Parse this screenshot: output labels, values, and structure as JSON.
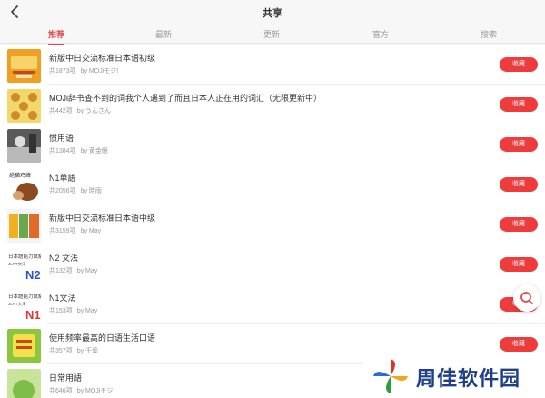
{
  "header": {
    "title": "共享"
  },
  "tabs": [
    {
      "label": "推荐",
      "active": true
    },
    {
      "label": "最新",
      "active": false
    },
    {
      "label": "更新",
      "active": false
    },
    {
      "label": "官方",
      "active": false
    },
    {
      "label": "搜索",
      "active": false
    }
  ],
  "items": [
    {
      "title": "新版中日交流标准日本语初级",
      "count": "共1873项",
      "author": "by MOJiモジ!",
      "collect_label": "收藏",
      "cover_colors": [
        "#f0a020",
        "#f6d36b"
      ]
    },
    {
      "title": "MOJi辞书查不到的词我个人遇到了而且日本人正在用的词汇（无限更新中）",
      "count": "共442项",
      "author": "by うんさん",
      "collect_label": "收藏",
      "cover_colors": [
        "#f2d76a",
        "#d08a2a"
      ]
    },
    {
      "title": "惯用语",
      "count": "共1384项",
      "author": "by 黄金眼",
      "collect_label": "收藏",
      "cover_colors": [
        "#5a5a5a",
        "#b9b9b9"
      ]
    },
    {
      "title": "N1单語",
      "count": "共2056项",
      "author": "by 時雨",
      "collect_label": "收藏",
      "cover_colors": [
        "#8a4a22",
        "#d8a06a"
      ]
    },
    {
      "title": "新版中日交流标准日本语中级",
      "count": "共3159项",
      "author": "by May",
      "collect_label": "收藏",
      "cover_colors": [
        "#f0b020",
        "#6aa84f"
      ]
    },
    {
      "title": "N2 文法",
      "count": "共132项",
      "author": "by May",
      "collect_label": "收藏",
      "cover_colors": [
        "#ffffff",
        "#2a56c6"
      ]
    },
    {
      "title": "N1文法",
      "count": "共153项",
      "author": "by May",
      "collect_label": "收藏",
      "cover_colors": [
        "#ffffff",
        "#d93a3a"
      ]
    },
    {
      "title": "使用频率最高的日语生活口语",
      "count": "共357项",
      "author": "by 千葉",
      "collect_label": "收藏",
      "cover_colors": [
        "#8cc63f",
        "#f4e04d"
      ]
    },
    {
      "title": "日常用語",
      "count": "共646项",
      "author": "by MOJiモジ!",
      "collect_label": "收藏",
      "cover_colors": [
        "#7dbd4a",
        "#c9e39b"
      ]
    }
  ],
  "cover_text": {
    "n1_tag": "絶猫鸡峰",
    "jlpt_title": "日本語能力試験",
    "jlpt_sub": "JLPT文法",
    "n2": "N2",
    "n1": "N1"
  },
  "watermark": {
    "text": "周佳软件园"
  },
  "icons": {
    "back": "chevron-left-icon",
    "search": "search-icon"
  }
}
